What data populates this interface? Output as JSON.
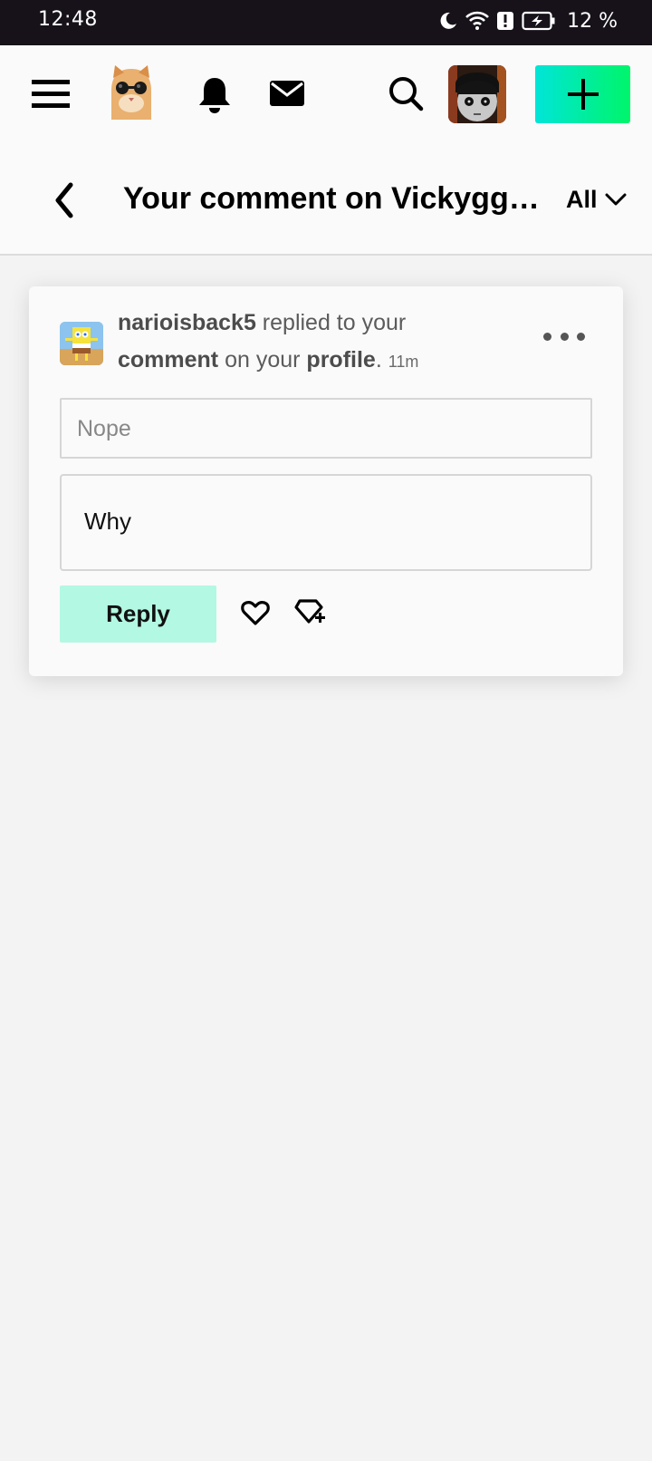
{
  "status_bar": {
    "time": "12:48",
    "battery": "12 %",
    "icons": [
      "moon-icon",
      "wifi-icon",
      "alert-icon",
      "battery-charging-icon"
    ]
  },
  "top_nav": {
    "icons": [
      "menu-icon",
      "cat-avatar",
      "bell-icon",
      "mail-icon",
      "search-icon",
      "profile-avatar",
      "plus-icon"
    ],
    "create_gradient": [
      "#00e5d8",
      "#00f56a"
    ]
  },
  "header": {
    "title": "Your comment on Vickygg…",
    "filter": "All"
  },
  "notification": {
    "username": "narioisback5",
    "text_replied": " replied to your",
    "comment_link": "comment",
    "text_on": " on your ",
    "profile_link": "profile",
    "period": ".",
    "timestamp": "11m",
    "quote": "Nope",
    "reply_text": "Why",
    "reply_button": "Reply",
    "reply_button_color": "#b3f8e2"
  }
}
